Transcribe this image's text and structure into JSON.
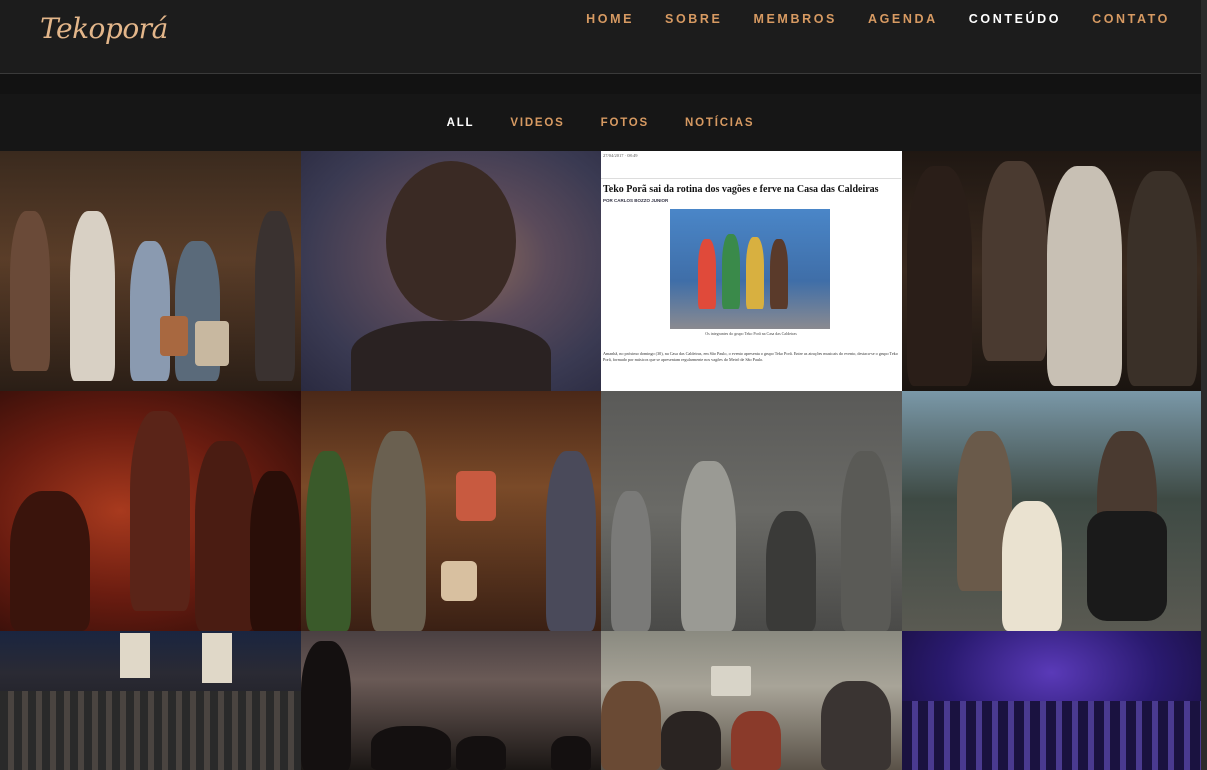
{
  "brand": {
    "logo_text": "Tekoporá"
  },
  "nav": {
    "items": [
      {
        "label": "HOME",
        "active": false
      },
      {
        "label": "SOBRE",
        "active": false
      },
      {
        "label": "MEMBROS",
        "active": false
      },
      {
        "label": "AGENDA",
        "active": false
      },
      {
        "label": "CONTEÚDO",
        "active": true
      },
      {
        "label": "CONTATO",
        "active": false
      }
    ]
  },
  "filters": {
    "items": [
      {
        "label": "ALL",
        "active": true
      },
      {
        "label": "VIDEOS",
        "active": false
      },
      {
        "label": "FOTOS",
        "active": false
      },
      {
        "label": "NOTÍCIAS",
        "active": false
      }
    ]
  },
  "news_clip": {
    "date": "27/04/2017 · 08:49",
    "headline": "Teko Porã sai da rotina dos vagões e ferve na Casa das Caldeiras",
    "byline": "POR CARLOS BOZZO JUNIOR",
    "caption": "Os integrantes do grupo Teko Porã na Casa das Caldeiras",
    "body": "Amanhã, no próximo domingo (30), na Casa das Caldeiras, em São Paulo, o evento apresenta o grupo Teko Porã. Entre as atrações musicais do evento, destaca-se o grupo Teko Porã, formado por músicos que se apresentam regularmente nos vagões do Metrô de São Paulo."
  },
  "colors": {
    "accent": "#d79a62",
    "active": "#ffffff",
    "header_bg": "#1c1c1c",
    "page_bg": "#121212"
  }
}
